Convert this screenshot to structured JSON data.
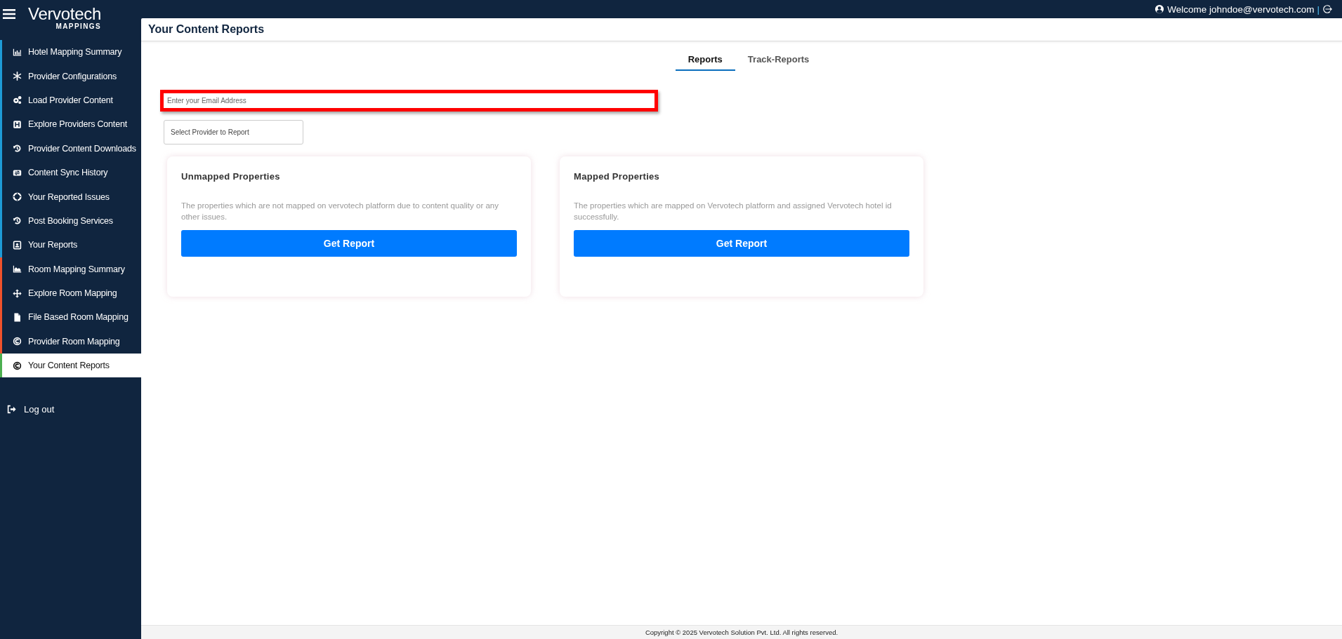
{
  "logo": {
    "name": "Vervotech",
    "sub": "MAPPINGS"
  },
  "sidebar": {
    "items": [
      {
        "label": "Hotel Mapping Summary",
        "color": "#1e9bd7",
        "selected": false
      },
      {
        "label": "Provider Configurations",
        "color": "#1e9bd7",
        "selected": false
      },
      {
        "label": "Load Provider Content",
        "color": "#1e9bd7",
        "selected": false
      },
      {
        "label": "Explore Providers Content",
        "color": "#1e9bd7",
        "selected": false
      },
      {
        "label": "Provider Content Downloads",
        "color": "#1e9bd7",
        "selected": false
      },
      {
        "label": "Content Sync History",
        "color": "#1e9bd7",
        "selected": false
      },
      {
        "label": "Your Reported Issues",
        "color": "#1e9bd7",
        "selected": false
      },
      {
        "label": "Post Booking Services",
        "color": "#1e9bd7",
        "selected": false
      },
      {
        "label": "Your Reports",
        "color": "#1e9bd7",
        "selected": false
      },
      {
        "label": "Room Mapping Summary",
        "color": "#f0522b",
        "selected": false
      },
      {
        "label": "Explore Room Mapping",
        "color": "#f0522b",
        "selected": false
      },
      {
        "label": "File Based Room Mapping",
        "color": "#f0522b",
        "selected": false
      },
      {
        "label": "Provider Room Mapping",
        "color": "#f0522b",
        "selected": false
      },
      {
        "label": "Your Content Reports",
        "color": "#4caf50",
        "selected": true
      }
    ],
    "logout": "Log out"
  },
  "topbar": {
    "welcome": "Welcome johndoe@vervotech.com",
    "separator": "|"
  },
  "page": {
    "title": "Your Content Reports"
  },
  "tabs": [
    {
      "label": "Reports",
      "selected": true
    },
    {
      "label": "Track-Reports",
      "selected": false
    }
  ],
  "email_field": {
    "placeholder": "Enter your Email Address",
    "highlighted": true
  },
  "provider_select": {
    "placeholder": "Select Provider to Report"
  },
  "cards": [
    {
      "title": "Unmapped Properties",
      "description": "The properties which are not mapped on vervotech platform due to content quality or any other issues.",
      "button": "Get Report"
    },
    {
      "title": "Mapped Properties",
      "description": "The properties which are mapped on Vervotech platform and assigned Vervotech hotel id successfully.",
      "button": "Get Report"
    }
  ],
  "footer": "Copyright © 2025 Vervotech Solution Pvt. Ltd. All rights reserved."
}
